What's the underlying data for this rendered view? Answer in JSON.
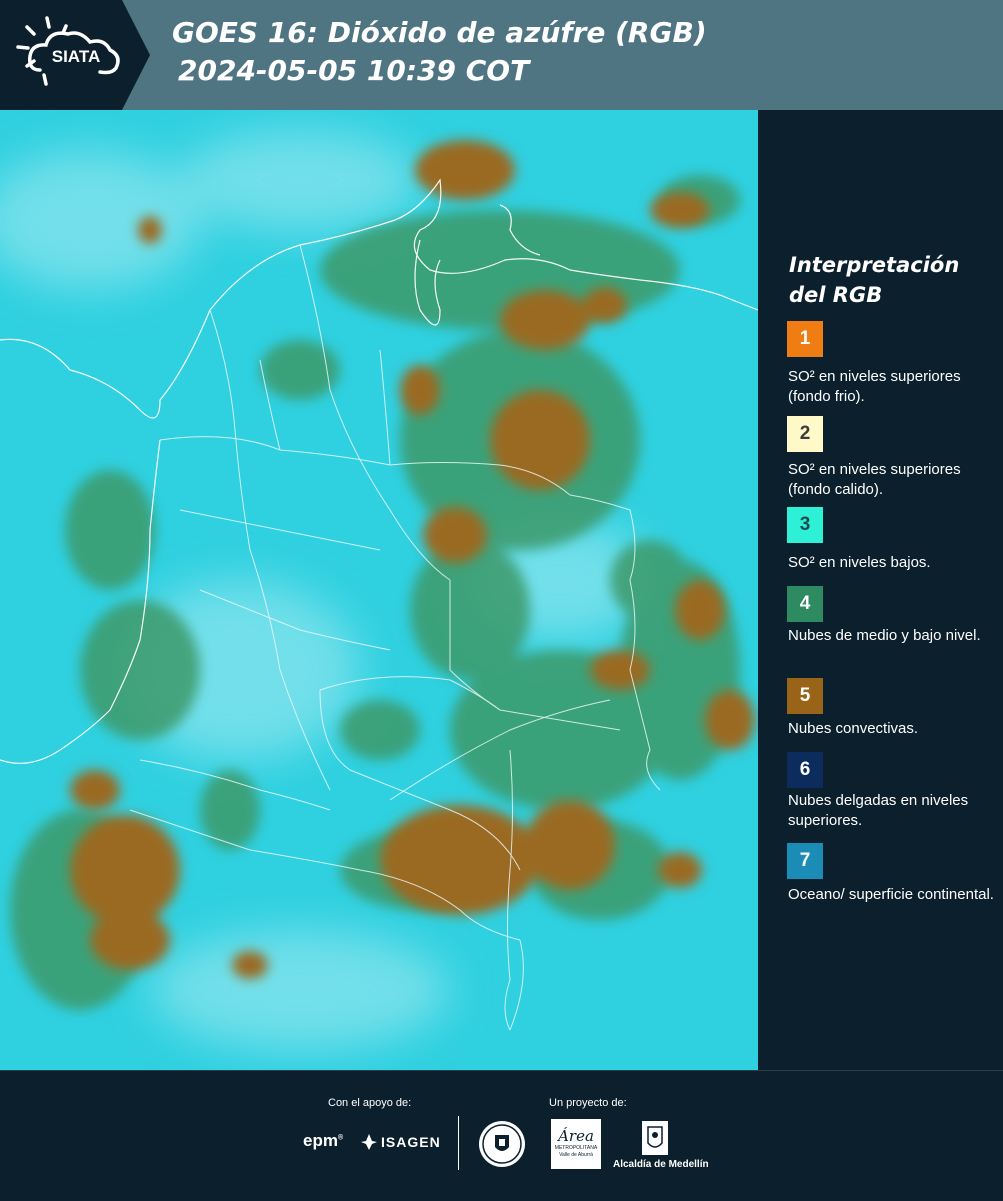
{
  "header": {
    "logo_text": "SIATA",
    "title_line1": "GOES 16: Dióxido de azúfre (RGB)",
    "title_line2": "2024-05-05 10:39 COT"
  },
  "legend": {
    "title_line1": "Interpretación",
    "title_line2": "del RGB",
    "items": [
      {
        "number": "1",
        "color": "#f07c14",
        "text_color": "#ffffff",
        "label": "SO² en niveles superiores (fondo frio)."
      },
      {
        "number": "2",
        "color": "#fff8c8",
        "text_color": "#3c3c3c",
        "label": "SO² en niveles superiores (fondo calido)."
      },
      {
        "number": "3",
        "color": "#2ef0d6",
        "text_color": "#1e4c50",
        "label": "SO² en niveles bajos."
      },
      {
        "number": "4",
        "color": "#2e8a60",
        "text_color": "#ffffff",
        "label": "Nubes de medio y bajo nivel."
      },
      {
        "number": "5",
        "color": "#9a6418",
        "text_color": "#ffffff",
        "label": "Nubes convectivas."
      },
      {
        "number": "6",
        "color": "#0c2c5e",
        "text_color": "#ffffff",
        "label": "Nubes delgadas en niveles superiores."
      },
      {
        "number": "7",
        "color": "#1a8cb6",
        "text_color": "#ffffff",
        "label": "Oceano/ superficie continental."
      }
    ]
  },
  "footer": {
    "support_label": "Con el apoyo de:",
    "project_label": "Un proyecto de:",
    "epm_text": "epm",
    "isagen_text": "ISAGEN",
    "area_text": "Área",
    "area_sub1": "METROPOLITANA",
    "area_sub2": "Valle de Aburrá",
    "alcaldia_text": "Alcaldía de Medellín"
  },
  "colors": {
    "background": "#0c1f2c",
    "header": "#4f7482",
    "map_base": "#2fd0e0"
  }
}
